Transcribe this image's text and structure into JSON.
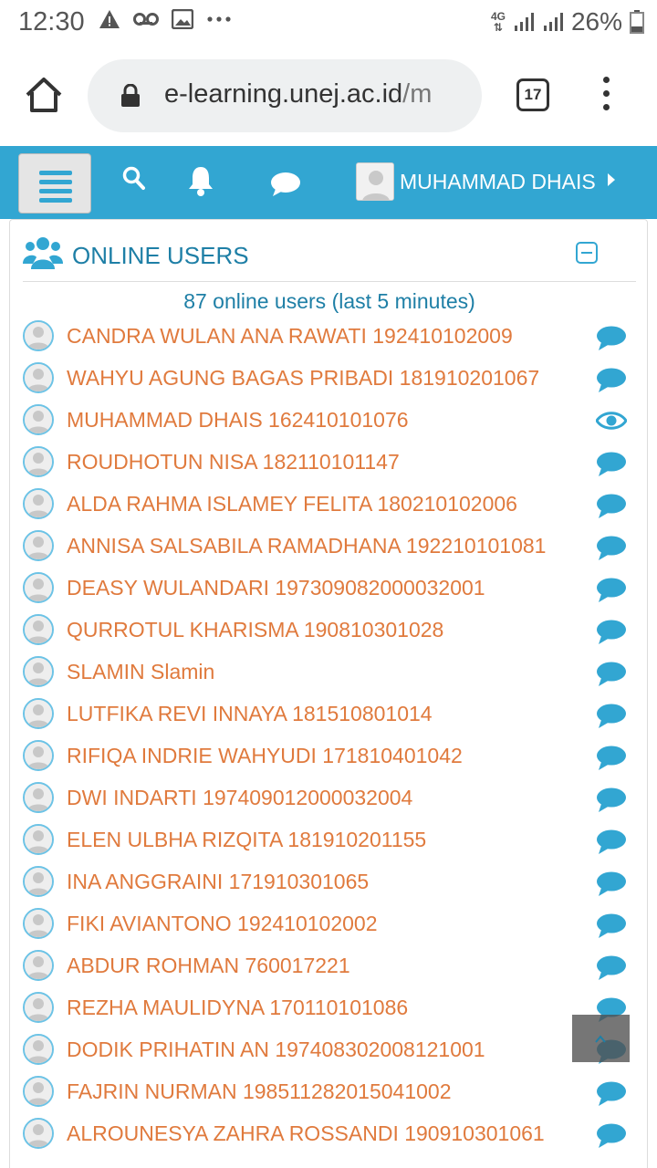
{
  "status_bar": {
    "time": "12:30",
    "network": "4G",
    "battery": "26%",
    "icons_left": [
      "warning-icon",
      "voicemail-icon",
      "image-icon",
      "more-icon"
    ]
  },
  "browser": {
    "url_main": "e-learning.unej.ac.id",
    "url_rest": "/m",
    "tab_count": "17"
  },
  "header": {
    "user_name": "MUHAMMAD DHAIS"
  },
  "block": {
    "title": "ONLINE USERS",
    "summary": "87 online users (last 5 minutes)"
  },
  "users": [
    {
      "name": "CANDRA WULAN ANA RAWATI 192410102009",
      "action": "message"
    },
    {
      "name": "WAHYU AGUNG BAGAS PRIBADI 181910201067",
      "action": "message"
    },
    {
      "name": "MUHAMMAD DHAIS 162410101076",
      "action": "visibility"
    },
    {
      "name": "ROUDHOTUN NISA 182110101147",
      "action": "message"
    },
    {
      "name": "ALDA RAHMA ISLAMEY FELITA 180210102006",
      "action": "message"
    },
    {
      "name": "ANNISA SALSABILA RAMADHANA 192210101081",
      "action": "message"
    },
    {
      "name": "DEASY WULANDARI 197309082000032001",
      "action": "message"
    },
    {
      "name": "QURROTUL KHARISMA 190810301028",
      "action": "message"
    },
    {
      "name": "SLAMIN Slamin",
      "action": "message"
    },
    {
      "name": "LUTFIKA REVI INNAYA 181510801014",
      "action": "message"
    },
    {
      "name": "RIFIQA INDRIE WAHYUDI 171810401042",
      "action": "message"
    },
    {
      "name": "DWI INDARTI 197409012000032004",
      "action": "message"
    },
    {
      "name": "ELEN ULBHA RIZQITA 181910201155",
      "action": "message"
    },
    {
      "name": "INA ANGGRAINI 171910301065",
      "action": "message"
    },
    {
      "name": "FIKI AVIANTONO 192410102002",
      "action": "message"
    },
    {
      "name": "ABDUR ROHMAN 760017221",
      "action": "message"
    },
    {
      "name": "REZHA MAULIDYNA 170110101086",
      "action": "message"
    },
    {
      "name": "DODIK PRIHATIN AN 197408302008121001",
      "action": "message"
    },
    {
      "name": "FAJRIN NURMAN 198511282015041002",
      "action": "message"
    },
    {
      "name": "ALROUNESYA ZAHRA ROSSANDI 190910301061",
      "action": "message"
    }
  ],
  "colors": {
    "header_bg": "#32a6d2",
    "title": "#1e7fa6",
    "user_link": "#e07a3d",
    "icon": "#32a6d2"
  }
}
